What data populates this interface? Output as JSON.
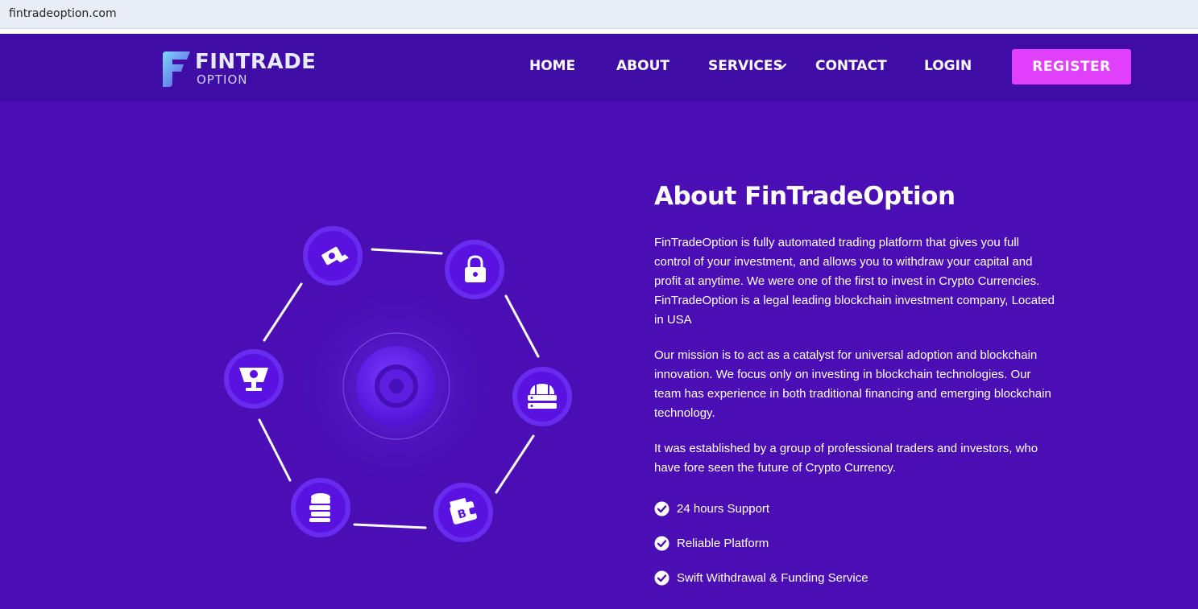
{
  "browser": {
    "url": "fintradeoption.com"
  },
  "brand": {
    "name_line1": "FINTRADE",
    "name_line2": "OPTION",
    "accent": "#e040fb",
    "nav_bg": "#400ca6",
    "hero_bg": "#4a0eb4"
  },
  "nav": {
    "home": "HOME",
    "about": "ABOUT",
    "services": "SERVICES",
    "contact": "CONTACT",
    "login": "LOGIN",
    "register": "REGISTER"
  },
  "about": {
    "title": "About FinTradeOption",
    "paragraphs": [
      "FinTradeOption is fully automated trading platform that gives you full control of your investment, and allows you to withdraw your capital and profit at anytime. We were one of the first to invest in Crypto Currencies. FinTradeOption is a legal leading blockchain investment company, Located in USA",
      "Our mission is to act as a catalyst for universal adoption and blockchain innovation. We focus only on investing in blockchain technologies. Our team has experience in both traditional financing and emerging blockchain technology.",
      "It was established by a group of professional traders and investors, who have fore seen the future of Crypto Currency."
    ],
    "features": [
      "24 hours Support",
      "Reliable Platform",
      "Swift Withdrawal & Funding Service"
    ]
  },
  "diagram": {
    "icons": [
      "cash-hand-icon",
      "lock-icon",
      "server-icon",
      "bitcoin-wallet-icon",
      "coin-stack-icon",
      "trophy-icon"
    ]
  }
}
